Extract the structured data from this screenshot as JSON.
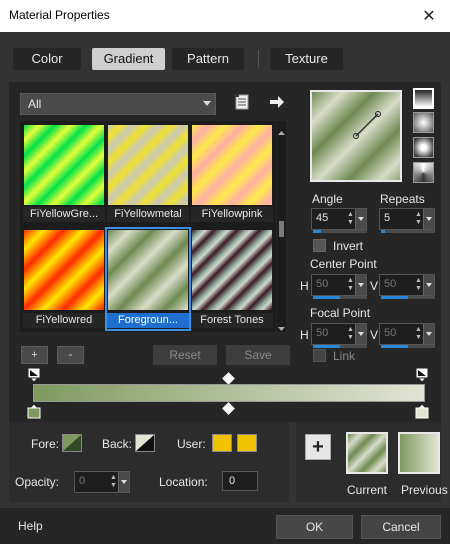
{
  "window": {
    "title": "Material Properties",
    "close": "✕"
  },
  "tabs": [
    {
      "label": "Color",
      "active": false
    },
    {
      "label": "Gradient",
      "active": true
    },
    {
      "label": "Pattern",
      "active": false
    },
    {
      "label": "Texture",
      "active": false
    }
  ],
  "category_select": {
    "value": "All"
  },
  "gradients": [
    {
      "label": "FiYellowGre...",
      "selected": false
    },
    {
      "label": "FiYellowmetal",
      "selected": false
    },
    {
      "label": "FiYellowpink",
      "selected": false
    },
    {
      "label": "FiYellowred",
      "selected": false
    },
    {
      "label": "Foregroun...",
      "selected": true
    },
    {
      "label": "Forest Tones",
      "selected": false
    }
  ],
  "list_buttons": {
    "add": "+",
    "remove": "-",
    "reset": "Reset",
    "save": "Save"
  },
  "angle": {
    "label": "Angle",
    "value": "45",
    "fraction": 0.125
  },
  "repeats": {
    "label": "Repeats",
    "value": "5",
    "fraction": 0.05
  },
  "invert": {
    "label": "Invert",
    "checked": false
  },
  "center_point": {
    "label": "Center Point",
    "h_label": "H",
    "h_value": "50",
    "v_label": "V",
    "v_value": "50"
  },
  "focal_point": {
    "label": "Focal Point",
    "h_label": "H",
    "h_value": "50",
    "v_label": "V",
    "v_value": "50"
  },
  "link": {
    "label": "Link",
    "checked": false
  },
  "editor": {
    "fore_label": "Fore:",
    "back_label": "Back:",
    "user_label": "User:",
    "opacity_label": "Opacity:",
    "opacity_value": "0",
    "location_label": "Location:",
    "location_value": "0",
    "user_color": "#f2c100"
  },
  "preview": {
    "current_label": "Current",
    "previous_label": "Previous",
    "add": "+"
  },
  "footer": {
    "help": "Help",
    "ok": "OK",
    "cancel": "Cancel"
  },
  "colors": {
    "accent": "#2a86d8",
    "fore": "#7e9a5f",
    "back": "#e2e4d4"
  }
}
